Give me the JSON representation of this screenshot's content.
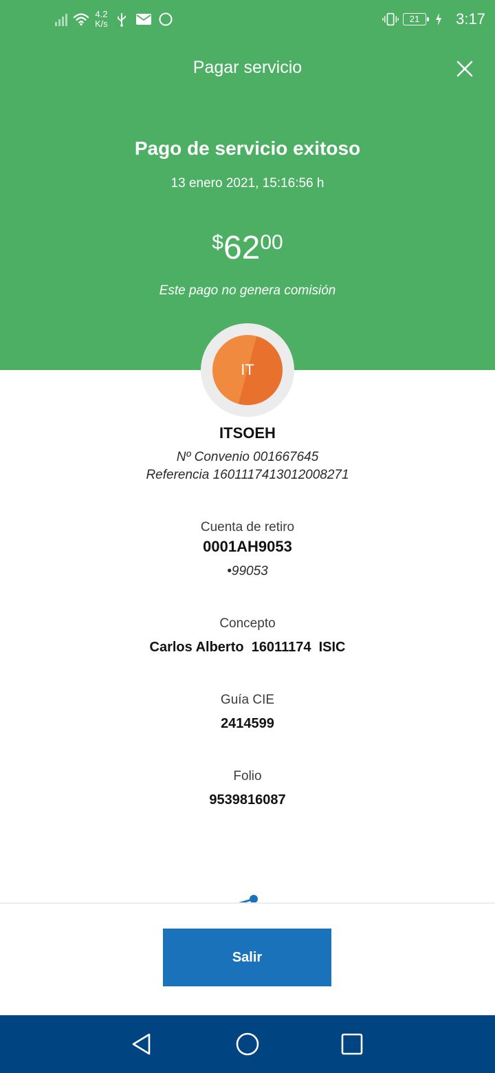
{
  "status_bar": {
    "net_speed_value": "4.2",
    "net_speed_unit": "K/s",
    "battery_level": "21",
    "time": "3:17",
    "icons": [
      "signal-icon",
      "wifi-icon",
      "usb-icon",
      "mail-icon",
      "sync-icon",
      "vibrate-icon",
      "battery-icon",
      "charging-icon"
    ]
  },
  "header": {
    "title": "Pagar servicio",
    "close_icon": "close-icon"
  },
  "receipt": {
    "status_title": "Pago de servicio exitoso",
    "datetime": "13 enero 2021, 15:16:56 h",
    "amount": {
      "currency": "$",
      "integer": "62",
      "decimals": "00"
    },
    "commission_note": "Este pago no genera comisión"
  },
  "biller": {
    "initials": "IT",
    "name": "ITSOEH",
    "agreement": "Nº Convenio 001667645",
    "reference": "Referencia 1601117413012008271"
  },
  "details": {
    "account_label": "Cuenta de retiro",
    "account_value": "0001AH9053",
    "account_masked": "•99053",
    "concept_label": "Concepto",
    "concept_value": "Carlos Alberto  16011174  ISIC",
    "guide_label": "Guía CIE",
    "guide_value": "2414599",
    "folio_label": "Folio",
    "folio_value": "9539816087"
  },
  "footer": {
    "exit_label": "Salir",
    "share_icon": "share-icon"
  },
  "colors": {
    "header_green": "#4caf64",
    "button_blue": "#1a73ba",
    "navbar_blue": "#004481",
    "avatar_orange": "#f08a3e"
  }
}
